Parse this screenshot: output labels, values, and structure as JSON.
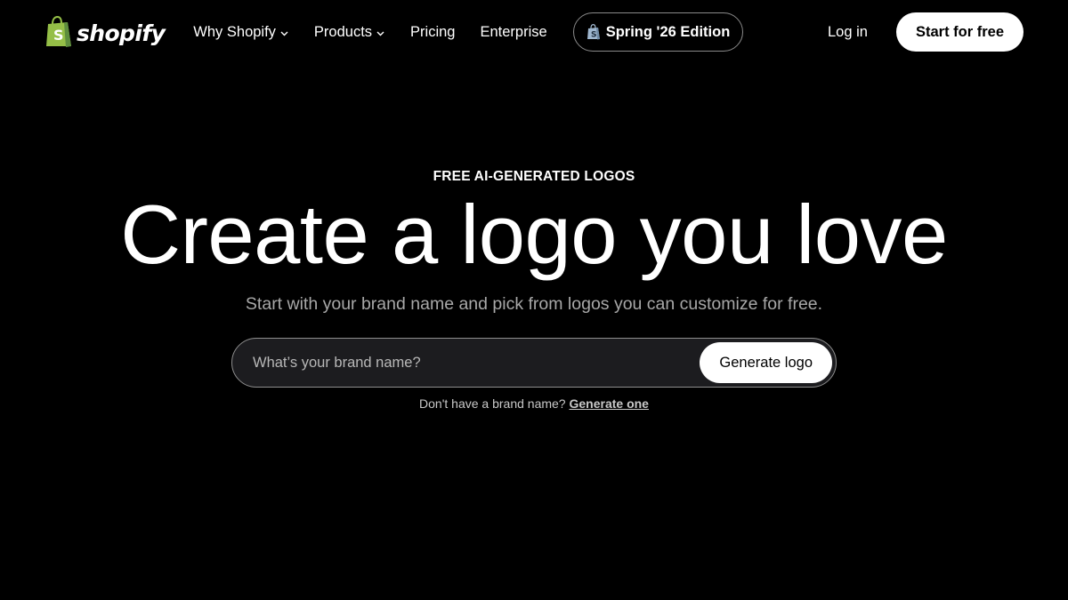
{
  "colors": {
    "background": "#000000",
    "text": "#ffffff",
    "muted_text": "#a8a8a8",
    "brand_green": "#95bf47",
    "brand_green_dark": "#5e8e3e",
    "button_bg": "#ffffff",
    "input_bg": "#1c1c1f"
  },
  "header": {
    "brand": {
      "name": "shopify",
      "icon": "shopify-bag-icon"
    },
    "nav": [
      {
        "label": "Why Shopify",
        "has_dropdown": true
      },
      {
        "label": "Products",
        "has_dropdown": true
      },
      {
        "label": "Pricing",
        "has_dropdown": false
      },
      {
        "label": "Enterprise",
        "has_dropdown": false
      }
    ],
    "edition": {
      "label": "Spring '26 Edition",
      "icon": "edition-bag-icon"
    },
    "login_label": "Log in",
    "cta_label": "Start for free"
  },
  "hero": {
    "eyebrow": "FREE AI-GENERATED LOGOS",
    "title": "Create a logo you love",
    "subtitle": "Start with your brand name and pick from logos you can customize for free.",
    "search": {
      "placeholder": "What’s your brand name?",
      "value": "",
      "button_label": "Generate logo"
    },
    "helper": {
      "text": "Don't have a brand name?",
      "link_label": "Generate one"
    }
  }
}
